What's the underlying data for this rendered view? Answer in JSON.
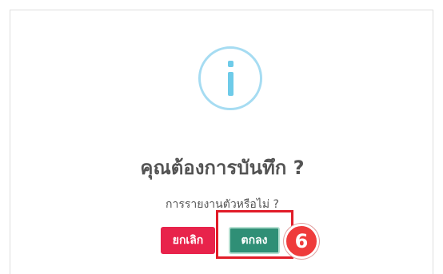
{
  "dialog": {
    "icon": "info-icon",
    "title": "คุณต้องการบันทึก ?",
    "message": "การรายงานตัวหรือไม่ ?",
    "cancel_label": "ยกเลิก",
    "ok_label": "ตกลง"
  },
  "annotation": {
    "step_number": "6"
  },
  "colors": {
    "cancel_button": "#e8234b",
    "ok_button": "#2f8f76",
    "info_icon": "#6ecbe9",
    "highlight": "#e11c28"
  }
}
